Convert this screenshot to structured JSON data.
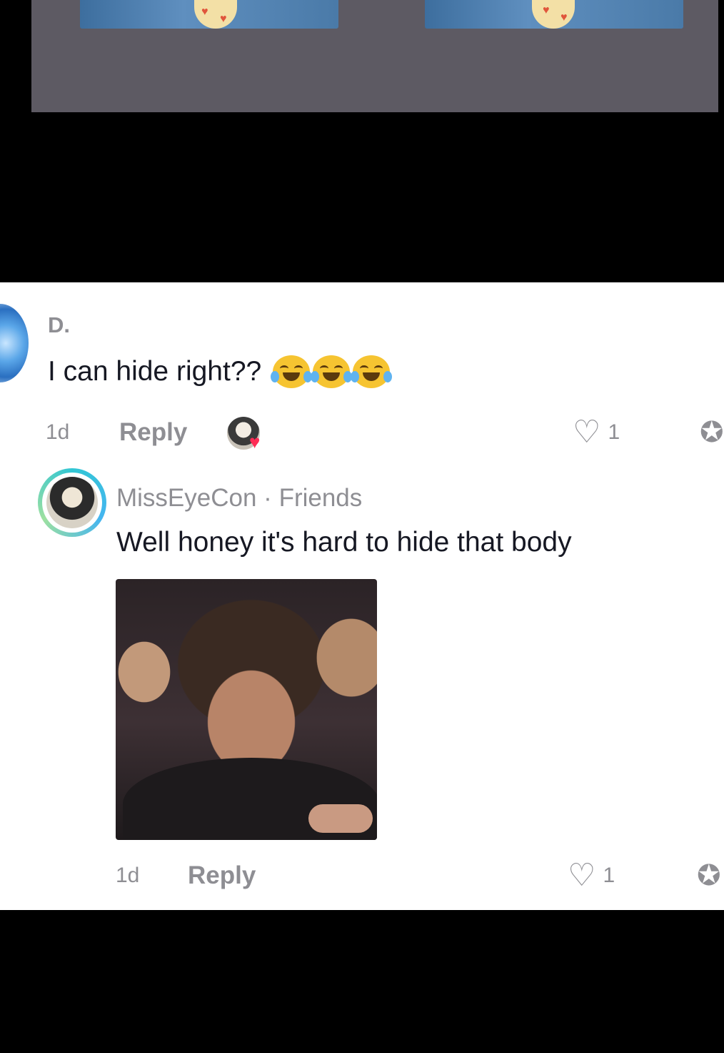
{
  "comment": {
    "username": "D.",
    "text": "I can hide right??",
    "emoji_count": 3,
    "time": "1d",
    "reply_label": "Reply",
    "like_count": "1"
  },
  "reply_comment": {
    "username": "MissEyeCon",
    "separator": " · ",
    "tag": "Friends",
    "text": "Well honey it's hard to hide that body",
    "time": "1d",
    "reply_label": "Reply",
    "like_count": "1"
  },
  "icons": {
    "like": "heart-outline-icon",
    "dislike": "thumb-down-icon",
    "creator_liked": "creator-heart-icon"
  },
  "colors": {
    "secondary_text": "#8e8e93",
    "primary_text": "#161823",
    "creator_heart": "#fe2c55",
    "avatar_ring": "#31c6d4"
  }
}
